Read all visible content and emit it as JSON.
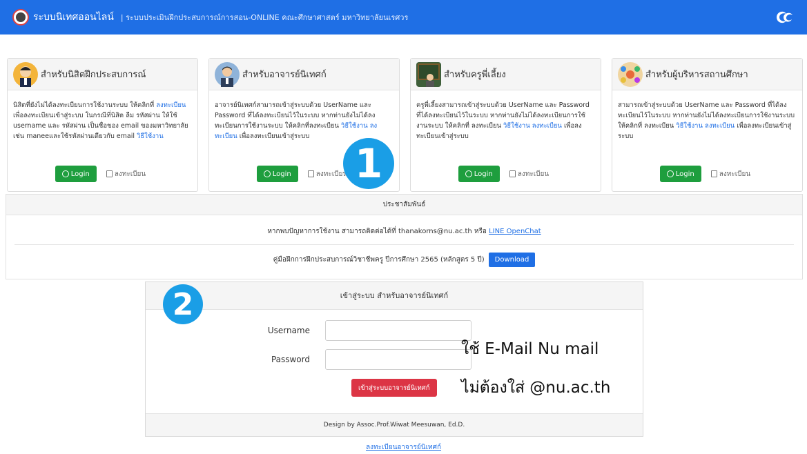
{
  "navbar": {
    "brand": "ระบบนิเทศออนไลน์",
    "subtitle": "| ระบบประเมินฝึกประสบการณ์การสอน-ONLINE คณะศึกษาศาสตร์ มหาวิทยาลัยนเรศวร",
    "right_icon": "university-logo-icon"
  },
  "cards": [
    {
      "title": "สำหรับนิสิตฝึกประสบการณ์",
      "body_text": "นิสิตที่ยังไม่ได้ลงทะเบียนการใช้งานระบบ ให้คลิกที่ ",
      "body_link1": "ลงทะเบียน",
      "body_text2": " เพื่อลงทะเบียนเข้าสู่ระบบ ในกรณีที่นิสิต ลืม รหัสผ่าน ให้ใช้ username และ รหัสผ่าน เป็นชื่อของ email ของมหาวิทยาลัย เช่น maneeและใช้รหัสผ่านเดียวกับ email ",
      "body_link2": "วิธีใช้งาน",
      "body_text3": "",
      "login_label": "Login",
      "register_label": "ลงทะเบียน",
      "avatar_color": "#f3b43a"
    },
    {
      "title": "สำหรับอาจารย์นิเทศก์",
      "body_text": "อาจารย์นิเทศก์สามารถเข้าสู่ระบบด้วย UserName และ Password ที่ได้ลงทะเบียนไว้ในระบบ หากท่านยังไม่ได้ลงทะเบียนการใช้งานระบบ ให้คลิกที่ลงทะเบียน ",
      "body_link1": "วิธีใช้งาน",
      "body_text2": " ",
      "body_link2": "ลงทะเบียน",
      "body_text3": " เพื่อลงทะเบียนเข้าสู่ระบบ",
      "login_label": "Login",
      "register_label": "ลงทะเบียน",
      "avatar_color": "#8fb3d9"
    },
    {
      "title": "สำหรับครูพี่เลี้ยง",
      "body_text": "ครูพี่เลี้ยงสามารถเข้าสู่ระบบด้วย UserName และ Password ที่ได้ลงทะเบียนไว้ในระบบ หากท่านยังไม่ได้ลงทะเบียนการใช้งานระบบ ให้คลิกที่ ลงทะเบียน ",
      "body_link1": "วิธีใช้งาน",
      "body_text2": " ",
      "body_link2": "ลงทะเบียน",
      "body_text3": " เพื่อลงทะเบียนเข้าสู่ระบบ",
      "login_label": "Login",
      "register_label": "ลงทะเบียน",
      "avatar_color": "#3f5f3a"
    },
    {
      "title": "สำหรับผู้บริหารสถานศึกษา",
      "body_text": "สามารถเข้าสู่ระบบด้วย UserName และ Password ที่ได้ลงทะเบียนไว้ในระบบ หากท่านยังไม่ได้ลงทะเบียนการใช้งานระบบ ให้คลิกที่ ลงทะเบียน ",
      "body_link1": "วิธีใช้งาน",
      "body_text2": " ",
      "body_link2": "ลงทะเบียน",
      "body_text3": " เพื่อลงทะเบียนเข้าสู่ระบบ",
      "login_label": "Login",
      "register_label": "ลงทะเบียน",
      "avatar_color": "#f0d5a0"
    }
  ],
  "markers": {
    "one": "1",
    "two": "2"
  },
  "pr": {
    "header": "ประชาสัมพันธ์",
    "contact_text": "หากพบปัญหาการใช้งาน สามารถติดต่อได้ที่ thanakorns@nu.ac.th หรือ ",
    "contact_link": "LINE OpenChat",
    "manual_text": "คู่มือฝึกการฝึกประสบการณ์วิชาชีพครู ปีการศึกษา 2565 (หลักสูตร 5 ปี)",
    "download_label": "Download"
  },
  "login": {
    "header": "เข้าสู่ระบบ สำหรับอาจารย์นิเทศก์",
    "username_label": "Username",
    "username_value": "",
    "password_label": "Password",
    "password_value": "",
    "submit_label": "เข้าสู่ระบบอาจารย์นิเทศก์",
    "footer": "Design by Assoc.Prof.Wiwat Meesuwan, Ed.D."
  },
  "register_link": "ลงทะเบียนอาจารย์นิเทศก์",
  "note": {
    "line1": "ใช้ E-Mail  Nu mail",
    "line2": "ไม่ต้องใส่ @nu.ac.th"
  }
}
